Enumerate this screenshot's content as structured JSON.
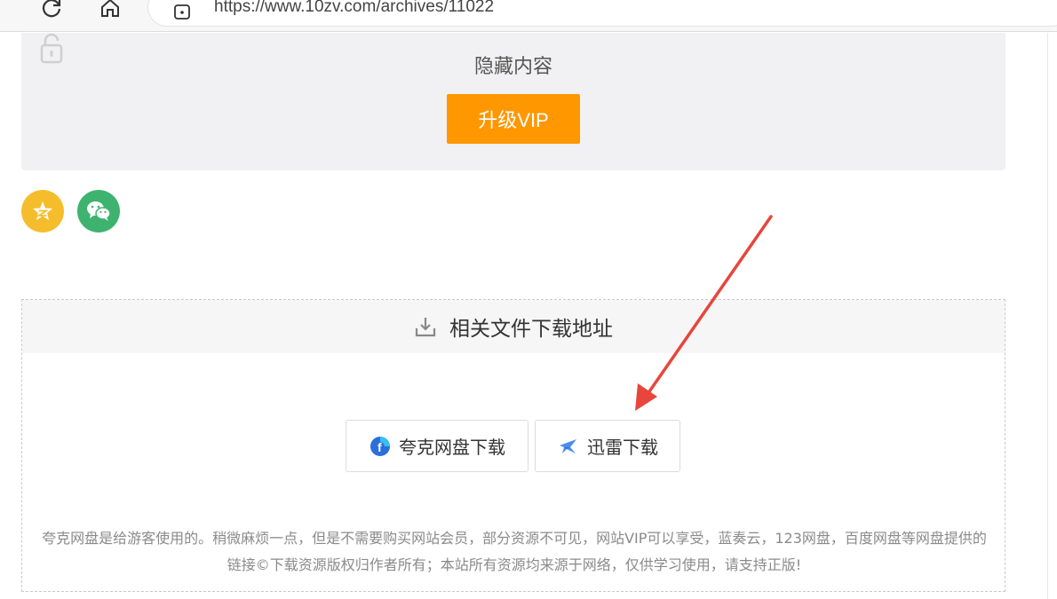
{
  "browser": {
    "url": "https://www.10zv.com/archives/11022",
    "icons": [
      "reload-icon",
      "home-icon",
      "site-info-icon"
    ]
  },
  "hidden_content": {
    "title": "隐藏内容",
    "vip_button_label": "升级VIP",
    "lock_icon": "unlock-icon",
    "vip_color": "#ff9800"
  },
  "share": {
    "icons": [
      "qzone-icon",
      "wechat-icon"
    ],
    "qzone_color": "#f5bd2c",
    "wechat_color": "#3eb370"
  },
  "download": {
    "header_title": "相关文件下载地址",
    "header_icon": "download-icon",
    "buttons": [
      {
        "label": "夸克网盘下载",
        "icon": "quark-icon"
      },
      {
        "label": "迅雷下载",
        "icon": "xunlei-icon"
      }
    ],
    "note": "夸克网盘是给游客使用的。稍微麻烦一点，但是不需要购买网站会员，部分资源不可见，网站VIP可以享受，蓝奏云，123网盘，百度网盘等网盘提供的链接©下载资源版权归作者所有；本站所有资源均来源于网络，仅供学习使用，请支持正版!"
  },
  "annotation": {
    "arrow_color": "#e8453c"
  }
}
